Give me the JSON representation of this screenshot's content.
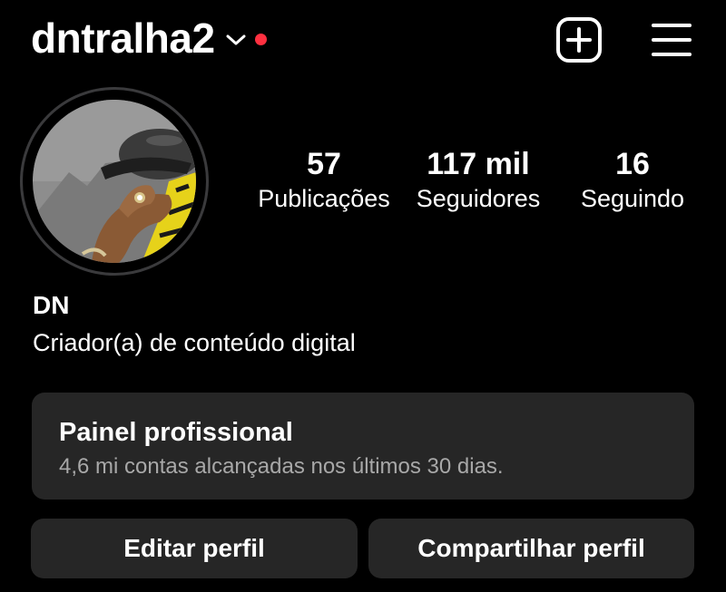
{
  "colors": {
    "background": "#000000",
    "text_primary": "#ffffff",
    "text_secondary": "#a8a8a8",
    "card_bg": "#262626",
    "notification_dot": "#ff3040"
  },
  "header": {
    "username": "dntralha2",
    "account_switcher_icon": "chevron-down-icon",
    "notification_indicator": "red-dot",
    "create_icon": "plus-square-icon",
    "menu_icon": "hamburger-menu-icon"
  },
  "profile": {
    "avatar_icon": "profile-photo",
    "stats": {
      "posts": {
        "value": "57",
        "label": "Publicações"
      },
      "followers": {
        "value": "117 mil",
        "label": "Seguidores"
      },
      "following": {
        "value": "16",
        "label": "Seguindo"
      }
    },
    "display_name": "DN",
    "category": "Criador(a) de conteúdo digital"
  },
  "dashboard": {
    "title": "Painel profissional",
    "subtitle": "4,6 mi contas alcançadas nos últimos 30 dias."
  },
  "actions": {
    "edit_profile": "Editar perfil",
    "share_profile": "Compartilhar perfil"
  }
}
